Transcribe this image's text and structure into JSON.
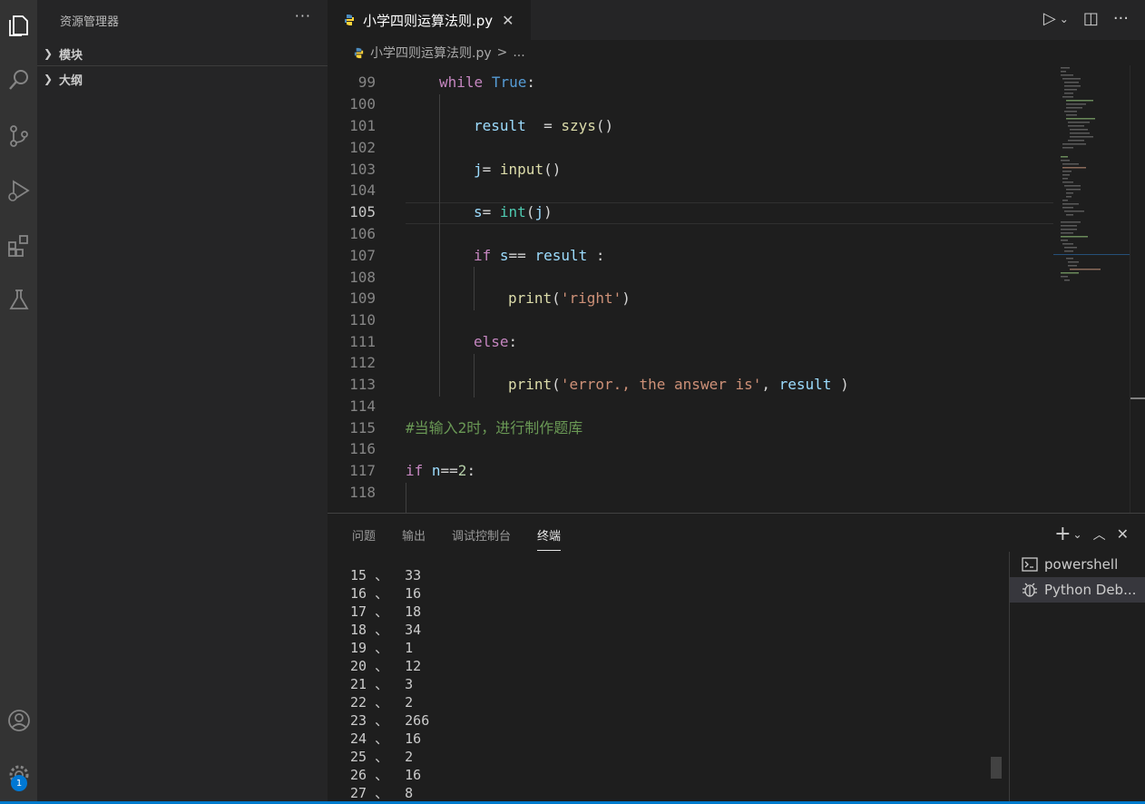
{
  "activity_bar": {
    "icons": [
      "explorer-icon",
      "search-icon",
      "source-control-icon",
      "run-debug-icon",
      "extensions-icon",
      "testing-icon",
      "account-icon",
      "settings-gear-icon"
    ],
    "settings_badge": "1"
  },
  "sidebar": {
    "title": "资源管理器",
    "more": "···",
    "sections": [
      {
        "label": "模块"
      },
      {
        "label": "大纲"
      }
    ]
  },
  "editor": {
    "tab": {
      "label": "小学四则运算法则.py",
      "close": "✕"
    },
    "breadcrumb": {
      "file": "小学四则运算法则.py",
      "sep": ">",
      "rest": "..."
    },
    "active_line": "105",
    "lines": [
      {
        "n": "99"
      },
      {
        "n": "100"
      },
      {
        "n": "101"
      },
      {
        "n": "102"
      },
      {
        "n": "103"
      },
      {
        "n": "104"
      },
      {
        "n": "105"
      },
      {
        "n": "106"
      },
      {
        "n": "107"
      },
      {
        "n": "108"
      },
      {
        "n": "109"
      },
      {
        "n": "110"
      },
      {
        "n": "111"
      },
      {
        "n": "112"
      },
      {
        "n": "113"
      },
      {
        "n": "114"
      },
      {
        "n": "115"
      },
      {
        "n": "116"
      },
      {
        "n": "117"
      },
      {
        "n": "118"
      }
    ],
    "code": {
      "l99_kw": "while",
      "l99_const": "True",
      "l99_rest": ":",
      "l101_var": "result",
      "l101_op": "  = ",
      "l101_fn": "szys",
      "l101_paren": "()",
      "l103_var": "j",
      "l103_op": "= ",
      "l103_fn": "input",
      "l103_paren": "()",
      "l105_var": "s",
      "l105_op": "= ",
      "l105_bi": "int",
      "l105_open": "(",
      "l105_arg": "j",
      "l105_close": ")",
      "l107_kw": "if",
      "l107_var": " s",
      "l107_op": "== ",
      "l107_var2": "result",
      "l107_rest": " :",
      "l109_fn": "print",
      "l109_open": "(",
      "l109_str": "'right'",
      "l109_close": ")",
      "l111_kw": "else",
      "l111_rest": ":",
      "l113_fn": "print",
      "l113_open": "(",
      "l113_str": "'error., the answer is'",
      "l113_comma": ", ",
      "l113_var": "result",
      "l113_close": " )",
      "l115_cmt": "#当输入2时，进行制作题库",
      "l117_kw": "if",
      "l117_var": " n",
      "l117_op": "==",
      "l117_num": "2",
      "l117_rest": ":"
    }
  },
  "panel": {
    "tabs": [
      "问题",
      "输出",
      "调试控制台",
      "终端"
    ],
    "active_tab": "终端",
    "terminal_lines": [
      "15 、  33",
      "16 、  16",
      "17 、  18",
      "18 、  34",
      "19 、  1",
      "20 、  12",
      "21 、  3",
      "22 、  2",
      "23 、  266",
      "24 、  16",
      "25 、  2",
      "26 、  16",
      "27 、  8"
    ],
    "terminals": [
      {
        "label": "powershell",
        "icon": "terminal-icon"
      },
      {
        "label": "Python Deb...",
        "icon": "debug-icon"
      }
    ]
  }
}
